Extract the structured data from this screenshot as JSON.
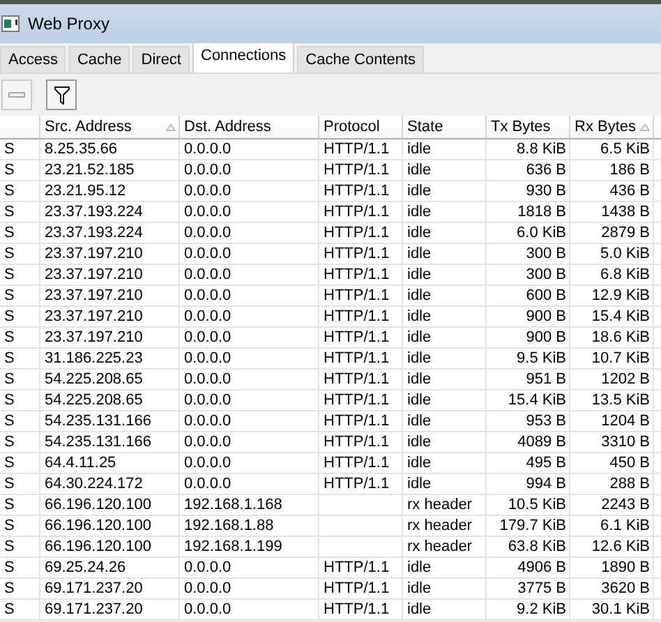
{
  "window": {
    "title": "Web Proxy"
  },
  "tabs": [
    {
      "label": "Access",
      "selected": false
    },
    {
      "label": "Cache",
      "selected": false
    },
    {
      "label": "Direct",
      "selected": false
    },
    {
      "label": "Connections",
      "selected": true
    },
    {
      "label": "Cache Contents",
      "selected": false
    }
  ],
  "toolbar": [
    {
      "kind": "remove",
      "disabled": true
    },
    {
      "kind": "filter",
      "disabled": false
    }
  ],
  "table": {
    "columns": [
      {
        "sorted": false
      },
      {
        "label": "Src. Address",
        "sorted": true
      },
      {
        "label": "Dst. Address",
        "sorted": false
      },
      {
        "label": "Protocol",
        "sorted": false
      },
      {
        "label": "State",
        "sorted": false
      },
      {
        "label": "Tx Bytes",
        "sorted": false
      },
      {
        "label": "Rx Bytes",
        "sorted": true
      }
    ],
    "rows": [
      [
        "S",
        "8.25.35.66",
        "0.0.0.0",
        "HTTP/1.1",
        "idle",
        "8.8 KiB",
        "6.5 KiB"
      ],
      [
        "S",
        "23.21.52.185",
        "0.0.0.0",
        "HTTP/1.1",
        "idle",
        "636 B",
        "186 B"
      ],
      [
        "S",
        "23.21.95.12",
        "0.0.0.0",
        "HTTP/1.1",
        "idle",
        "930 B",
        "436 B"
      ],
      [
        "S",
        "23.37.193.224",
        "0.0.0.0",
        "HTTP/1.1",
        "idle",
        "1818 B",
        "1438 B"
      ],
      [
        "S",
        "23.37.193.224",
        "0.0.0.0",
        "HTTP/1.1",
        "idle",
        "6.0 KiB",
        "2879 B"
      ],
      [
        "S",
        "23.37.197.210",
        "0.0.0.0",
        "HTTP/1.1",
        "idle",
        "300 B",
        "5.0 KiB"
      ],
      [
        "S",
        "23.37.197.210",
        "0.0.0.0",
        "HTTP/1.1",
        "idle",
        "300 B",
        "6.8 KiB"
      ],
      [
        "S",
        "23.37.197.210",
        "0.0.0.0",
        "HTTP/1.1",
        "idle",
        "600 B",
        "12.9 KiB"
      ],
      [
        "S",
        "23.37.197.210",
        "0.0.0.0",
        "HTTP/1.1",
        "idle",
        "900 B",
        "15.4 KiB"
      ],
      [
        "S",
        "23.37.197.210",
        "0.0.0.0",
        "HTTP/1.1",
        "idle",
        "900 B",
        "18.6 KiB"
      ],
      [
        "S",
        "31.186.225.23",
        "0.0.0.0",
        "HTTP/1.1",
        "idle",
        "9.5 KiB",
        "10.7 KiB"
      ],
      [
        "S",
        "54.225.208.65",
        "0.0.0.0",
        "HTTP/1.1",
        "idle",
        "951 B",
        "1202 B"
      ],
      [
        "S",
        "54.225.208.65",
        "0.0.0.0",
        "HTTP/1.1",
        "idle",
        "15.4 KiB",
        "13.5 KiB"
      ],
      [
        "S",
        "54.235.131.166",
        "0.0.0.0",
        "HTTP/1.1",
        "idle",
        "953 B",
        "1204 B"
      ],
      [
        "S",
        "54.235.131.166",
        "0.0.0.0",
        "HTTP/1.1",
        "idle",
        "4089 B",
        "3310 B"
      ],
      [
        "S",
        "64.4.11.25",
        "0.0.0.0",
        "HTTP/1.1",
        "idle",
        "495 B",
        "450 B"
      ],
      [
        "S",
        "64.30.224.172",
        "0.0.0.0",
        "HTTP/1.1",
        "idle",
        "994 B",
        "288 B"
      ],
      [
        "S",
        "66.196.120.100",
        "192.168.1.168",
        "",
        "rx header",
        "10.5 KiB",
        "2243 B"
      ],
      [
        "S",
        "66.196.120.100",
        "192.168.1.88",
        "",
        "rx header",
        "179.7 KiB",
        "6.1 KiB"
      ],
      [
        "S",
        "66.196.120.100",
        "192.168.1.199",
        "",
        "rx header",
        "63.8 KiB",
        "12.6 KiB"
      ],
      [
        "S",
        "69.25.24.26",
        "0.0.0.0",
        "HTTP/1.1",
        "idle",
        "4906 B",
        "1890 B"
      ],
      [
        "S",
        "69.171.237.20",
        "0.0.0.0",
        "HTTP/1.1",
        "idle",
        "3775 B",
        "3620 B"
      ],
      [
        "S",
        "69.171.237.20",
        "0.0.0.0",
        "HTTP/1.1",
        "idle",
        "9.2 KiB",
        "30.1 KiB"
      ]
    ]
  }
}
